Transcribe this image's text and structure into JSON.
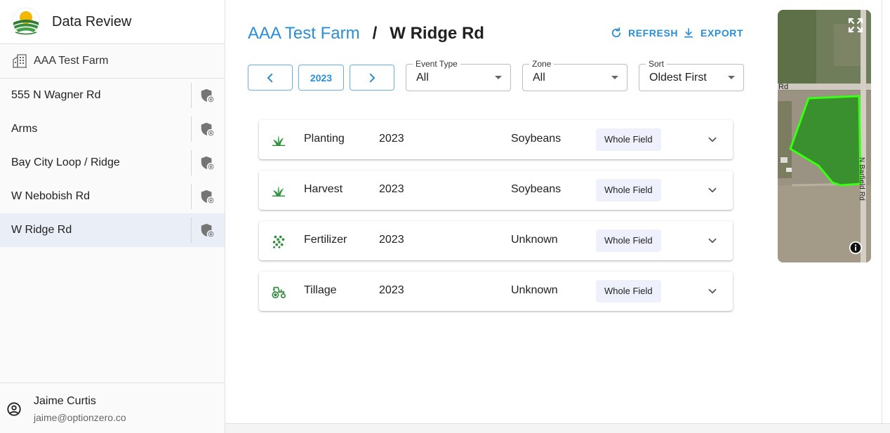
{
  "app": {
    "title": "Data Review"
  },
  "sidebar": {
    "farm_label": "AAA Test Farm",
    "fields": [
      {
        "label": "555 N Wagner Rd",
        "selected": false
      },
      {
        "label": "Arms",
        "selected": false
      },
      {
        "label": "Bay City Loop / Ridge",
        "selected": false
      },
      {
        "label": "W Nebobish Rd",
        "selected": false
      },
      {
        "label": "W Ridge Rd",
        "selected": true
      }
    ]
  },
  "user": {
    "name": "Jaime Curtis",
    "email": "jaime@optionzero.co"
  },
  "breadcrumb": {
    "farm": "AAA Test Farm",
    "separator": "/",
    "field": "W Ridge Rd"
  },
  "actions": {
    "refresh": "REFRESH",
    "export": "EXPORT"
  },
  "filters": {
    "year": "2023",
    "event_type": {
      "label": "Event Type",
      "value": "All"
    },
    "zone": {
      "label": "Zone",
      "value": "All"
    },
    "sort": {
      "label": "Sort",
      "value": "Oldest First"
    }
  },
  "events": [
    {
      "type": "Planting",
      "year": "2023",
      "crop": "Soybeans",
      "zone": "Whole Field",
      "icon": "sprout-icon"
    },
    {
      "type": "Harvest",
      "year": "2023",
      "crop": "Soybeans",
      "zone": "Whole Field",
      "icon": "sprout-icon"
    },
    {
      "type": "Fertilizer",
      "year": "2023",
      "crop": "Unknown",
      "zone": "Whole Field",
      "icon": "granules-icon"
    },
    {
      "type": "Tillage",
      "year": "2023",
      "crop": "Unknown",
      "zone": "Whole Field",
      "icon": "tractor-icon"
    }
  ],
  "map": {
    "road_label_left": "Rd",
    "road_label_vertical": "N Barfield Rd"
  },
  "colors": {
    "accent": "#2a8ed6",
    "selected_bg": "#e9eef7",
    "icon_green": "#2e8b3a",
    "field_outline": "#39ff14"
  }
}
